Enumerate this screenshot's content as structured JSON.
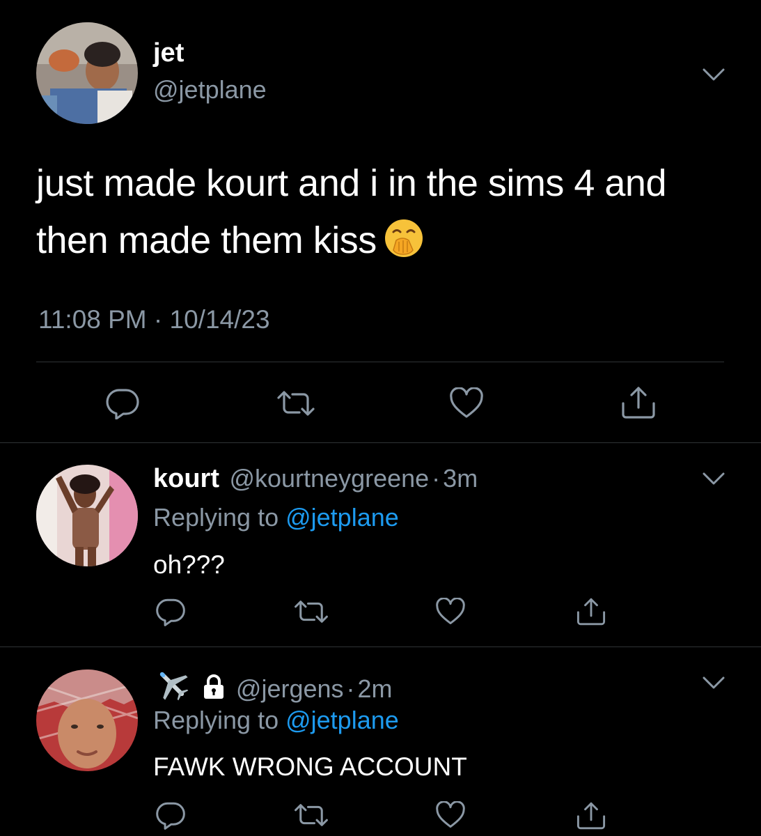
{
  "main_tweet": {
    "display_name": "jet",
    "handle": "@jetplane",
    "text": "just made kourt and i in the sims 4 and then made them kiss",
    "emoji": "hand-over-mouth-emoji",
    "timestamp": "11:08 PM · 10/14/23"
  },
  "replies": [
    {
      "display_name": "kourt",
      "handle": "@kourtneygreene",
      "sep": "·",
      "age": "3m",
      "replying_prefix": "Replying to ",
      "replying_to": "@jetplane",
      "text": "oh???"
    },
    {
      "display_name": "✈️",
      "locked": true,
      "handle": "@jergens",
      "sep": "·",
      "age": "2m",
      "replying_prefix": "Replying to ",
      "replying_to": "@jetplane",
      "text": "FAWK WRONG ACCOUNT"
    }
  ],
  "icons": {
    "reply": "reply-icon",
    "retweet": "retweet-icon",
    "like": "like-icon",
    "share": "share-icon",
    "more": "chevron-down-icon"
  },
  "colors": {
    "background": "#000000",
    "text": "#ffffff",
    "secondary": "#8b98a5",
    "link": "#1d9bf0",
    "divider": "#2f3336"
  }
}
